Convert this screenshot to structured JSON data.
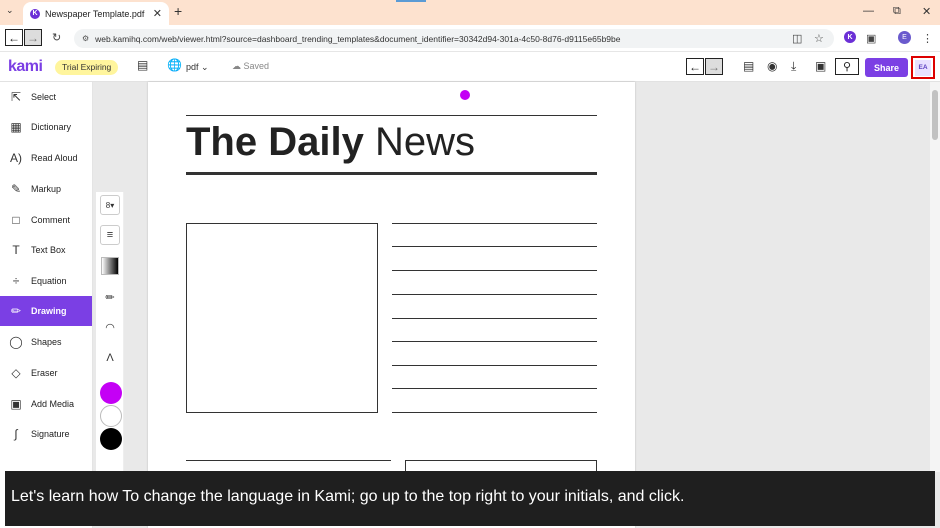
{
  "browser": {
    "tab_title": "Newspaper Template.pdf",
    "tab_favicon": "K",
    "url": "web.kamihq.com/web/viewer.html?source=dashboard_trending_templates&document_identifier=30342d94-301a-4c50-8d76-d9115e65b9be",
    "profile_initial": "E",
    "ext_initial": "K"
  },
  "kami": {
    "logo": "kami",
    "trial_badge": "Trial Expiring",
    "language_label": "pdf",
    "save_status": "Saved",
    "share_label": "Share",
    "user_initials": "EA"
  },
  "sidebar": {
    "items": [
      {
        "label": "Select",
        "icon": "cursor-icon"
      },
      {
        "label": "Dictionary",
        "icon": "dictionary-icon"
      },
      {
        "label": "Read Aloud",
        "icon": "read-aloud-icon"
      },
      {
        "label": "Markup",
        "icon": "highlighter-icon"
      },
      {
        "label": "Comment",
        "icon": "comment-icon"
      },
      {
        "label": "Text Box",
        "icon": "text-icon"
      },
      {
        "label": "Equation",
        "icon": "equation-icon"
      },
      {
        "label": "Drawing",
        "icon": "pen-icon"
      },
      {
        "label": "Shapes",
        "icon": "shapes-icon"
      },
      {
        "label": "Eraser",
        "icon": "eraser-icon"
      },
      {
        "label": "Add Media",
        "icon": "media-icon"
      },
      {
        "label": "Signature",
        "icon": "signature-icon"
      }
    ],
    "active": "Drawing"
  },
  "drawing_tools": {
    "stroke_size": "8",
    "colors": [
      "#c400f5",
      "#ffffff",
      "#000000"
    ],
    "selected_color": "#c400f5"
  },
  "document": {
    "headline_bold": "The Daily",
    "headline_light": "News"
  },
  "caption": "Let's learn how To change the language in Kami; go up to the top right to your initials, and click.",
  "colors": {
    "accent": "#7b3fe4",
    "highlight": "#dd0000"
  }
}
